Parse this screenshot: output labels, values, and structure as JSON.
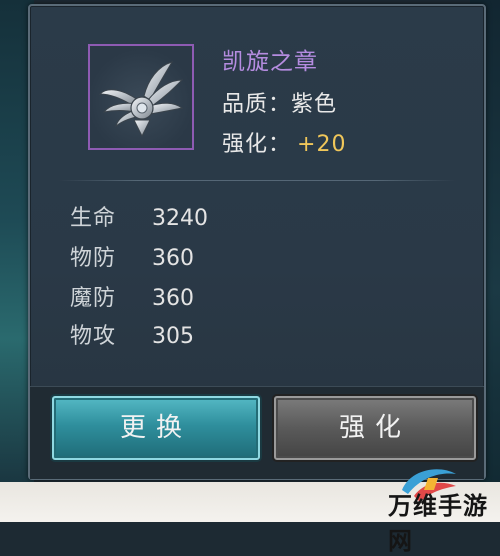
{
  "item": {
    "name": "凯旋之章",
    "quality_label": "品质：",
    "quality_value": "紫色",
    "enhance_label": "强化：",
    "enhance_value": "+20",
    "icon": "winged-emblem-icon",
    "frame_color": "#8e5bb3"
  },
  "stats": [
    {
      "label": "生命",
      "value": "3240"
    },
    {
      "label": "物防",
      "value": "360"
    },
    {
      "label": "魔防",
      "value": "360"
    },
    {
      "label": "物攻",
      "value": "305"
    }
  ],
  "buttons": {
    "change_label": "更换",
    "enhance_label": "强化"
  },
  "watermark": {
    "text": "万维手游网"
  },
  "colors": {
    "name": "#b58ce0",
    "enhance_value": "#f0c75a",
    "change_button": "#2f8f9d",
    "enhance_button": "#5a5a5a"
  }
}
